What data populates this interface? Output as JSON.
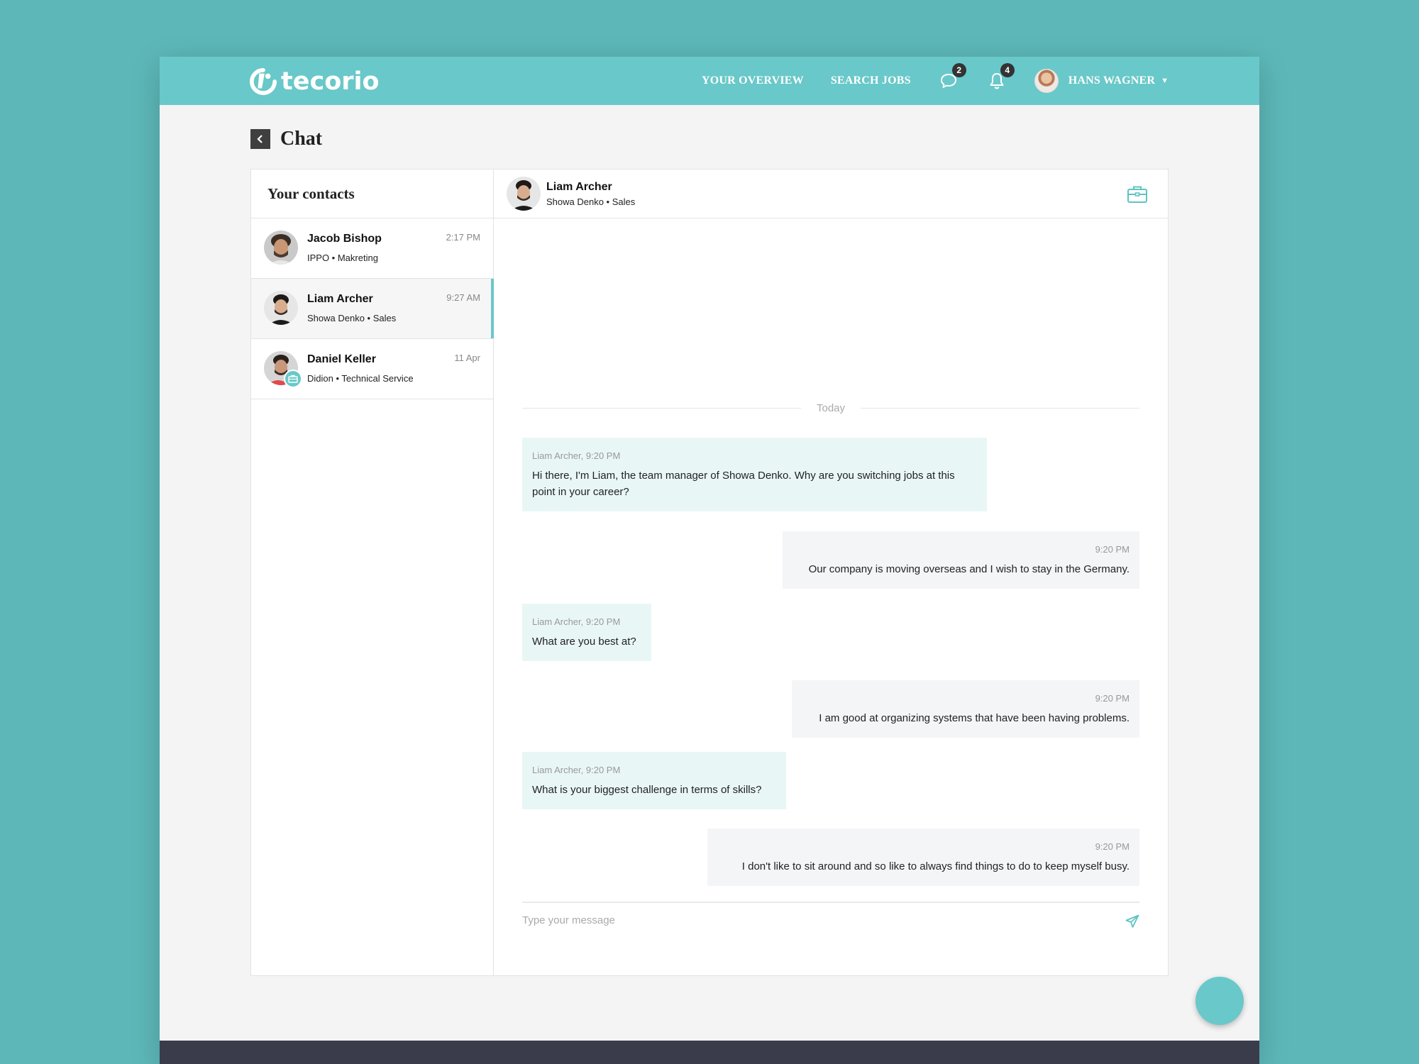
{
  "brand": {
    "name": "tecorio"
  },
  "nav": {
    "links": [
      "YOUR OVERVIEW",
      "SEARCH JOBS"
    ],
    "messages_count": "2",
    "notifications_count": "4",
    "user_name": "HANS WAGNER"
  },
  "page": {
    "title": "Chat"
  },
  "contacts": {
    "heading": "Your contacts",
    "items": [
      {
        "name": "Jacob Bishop",
        "subtitle": "IPPO • Makreting",
        "time": "2:17 PM"
      },
      {
        "name": "Liam Archer",
        "subtitle": "Showa Denko • Sales",
        "time": "9:27 AM"
      },
      {
        "name": "Daniel Keller",
        "subtitle": "Didion • Technical Service",
        "time": "11 Apr"
      }
    ]
  },
  "chat": {
    "contact_name": "Liam Archer",
    "contact_subtitle": "Showa Denko • Sales",
    "date_divider": "Today",
    "messages": [
      {
        "meta": "Liam Archer, 9:20 PM",
        "text": "Hi there, I'm Liam, the team manager of Showa Denko. Why are you switching jobs at this point in your career?"
      },
      {
        "meta": "9:20 PM",
        "text": "Our company is moving overseas and I wish to stay in the Germany."
      },
      {
        "meta": "Liam Archer, 9:20 PM",
        "text": "What are you best at?"
      },
      {
        "meta": "9:20 PM",
        "text": "I am good at organizing systems that have been having problems."
      },
      {
        "meta": "Liam Archer, 9:20 PM",
        "text": "What is your biggest challenge in terms of skills?"
      },
      {
        "meta": "9:20 PM",
        "text": "I don't like to sit around and so like to always find things to do to keep myself busy."
      }
    ],
    "input_placeholder": "Type your message"
  },
  "colors": {
    "accent": "#69c8c9",
    "background": "#5db7b8",
    "footer": "#3a3c4c"
  }
}
